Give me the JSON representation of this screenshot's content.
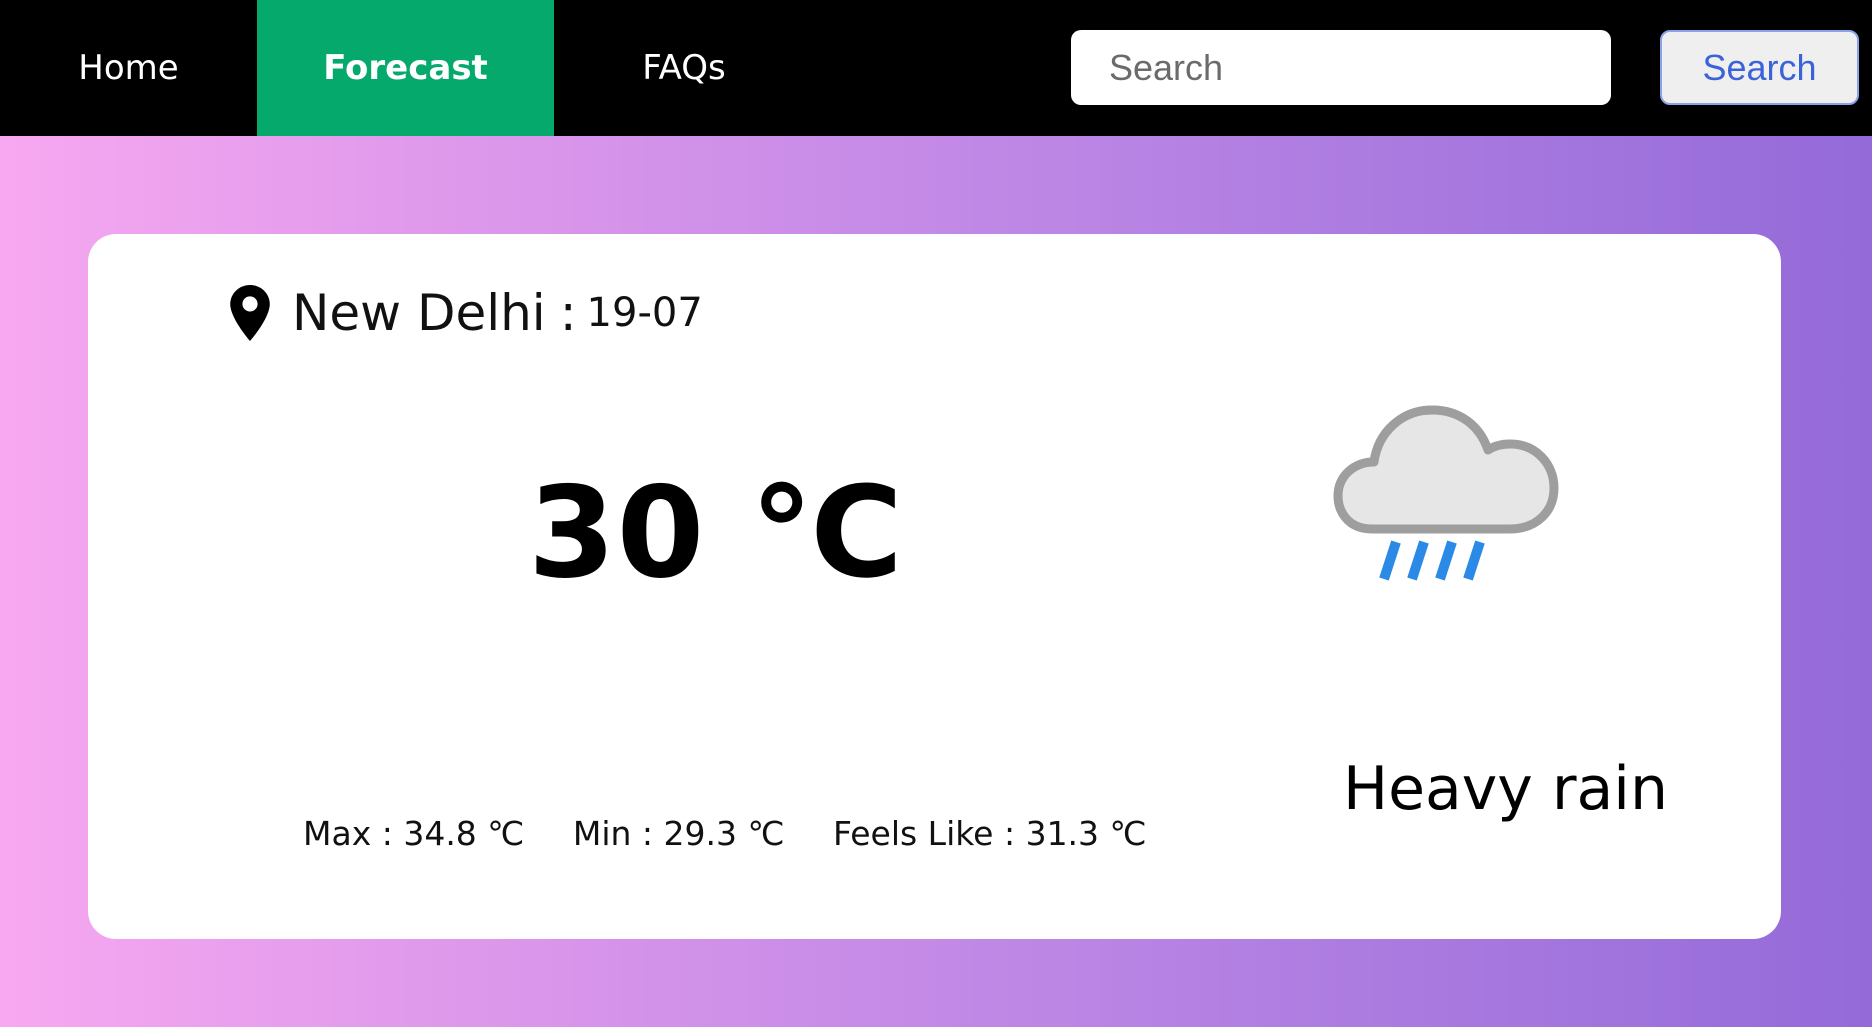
{
  "nav": {
    "home": "Home",
    "forecast": "Forecast",
    "faqs": "FAQs",
    "active": "Forecast",
    "active_color": "#06a96c"
  },
  "search": {
    "placeholder": "Search",
    "value": "",
    "button_label": "Search"
  },
  "weather": {
    "location_icon": "map-pin-icon",
    "city": "New Delhi",
    "separator": ":",
    "date": "19-07",
    "temperature": "30 ℃",
    "condition_icon": "heavy-rain-cloud-icon",
    "condition": "Heavy rain",
    "max": "Max : 34.8 ℃",
    "min": "Min : 29.3 ℃",
    "feels_like": "Feels Like : 31.3 ℃"
  },
  "colors": {
    "background_gradient": [
      "#f7a8f0",
      "#946ad9"
    ],
    "navbar": "#000000",
    "rain": "#2b8ae6"
  }
}
